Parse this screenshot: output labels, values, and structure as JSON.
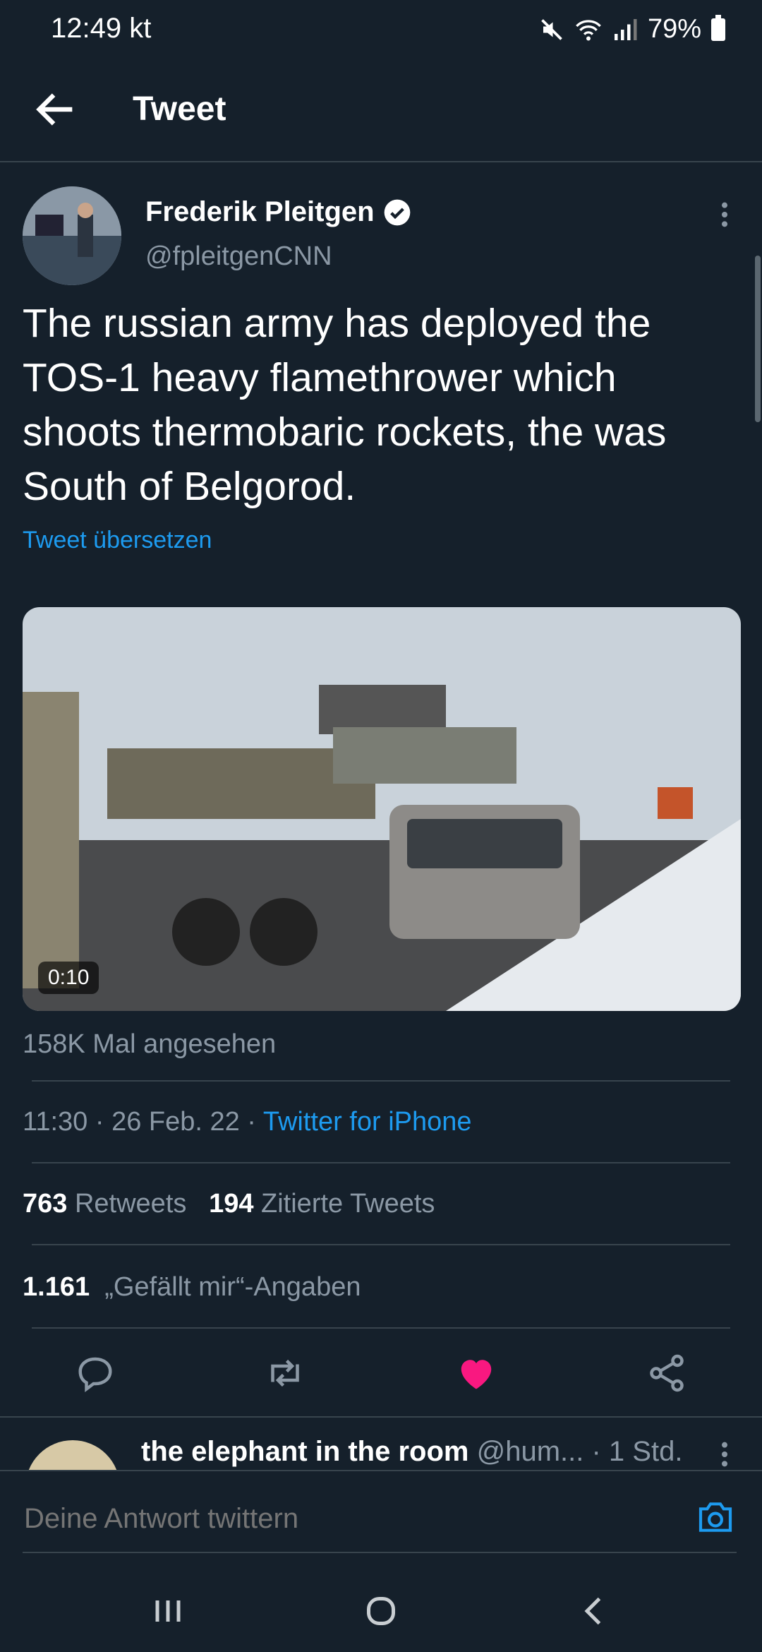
{
  "status_bar": {
    "time": "12:49 kt",
    "battery": "79%",
    "icons": [
      "mute-icon",
      "wifi-icon",
      "signal-icon",
      "battery-icon"
    ]
  },
  "header": {
    "title": "Tweet",
    "back_icon": "arrow-left-icon"
  },
  "tweet": {
    "author_name": "Frederik Pleitgen",
    "author_handle": "@fpleitgenCNN",
    "verified_icon": "verified-badge-icon",
    "text": "The russian army has deployed the TOS-1 heavy flamethrower which shoots thermobaric rockets, the was South of Belgorod.",
    "translate_label": "Tweet übersetzen",
    "video_duration": "0:10",
    "views": "158K Mal angesehen",
    "time": "11:30",
    "date": "26 Feb. 22",
    "source": "Twitter for iPhone",
    "retweets_count": "763",
    "retweets_label": "Retweets",
    "quotes_count": "194",
    "quotes_label": "Zitierte Tweets",
    "likes_count": "1.161",
    "likes_label": "„Gefällt mir“-Angaben",
    "liked": true,
    "like_color": "#f91880"
  },
  "actions": [
    "reply-icon",
    "retweet-icon",
    "like-icon",
    "share-icon"
  ],
  "reply_preview": {
    "name": "the elephant in the room",
    "handle": "@hum...",
    "time": "· 1 Std."
  },
  "composer": {
    "placeholder": "Deine Antwort twittern",
    "camera_icon": "camera-icon"
  },
  "nav_bar": [
    "recents-icon",
    "home-icon",
    "back-icon"
  ],
  "colors": {
    "background": "#15202b",
    "accent": "#1d9bf0",
    "muted": "#8b98a5",
    "divider": "#38444d"
  }
}
